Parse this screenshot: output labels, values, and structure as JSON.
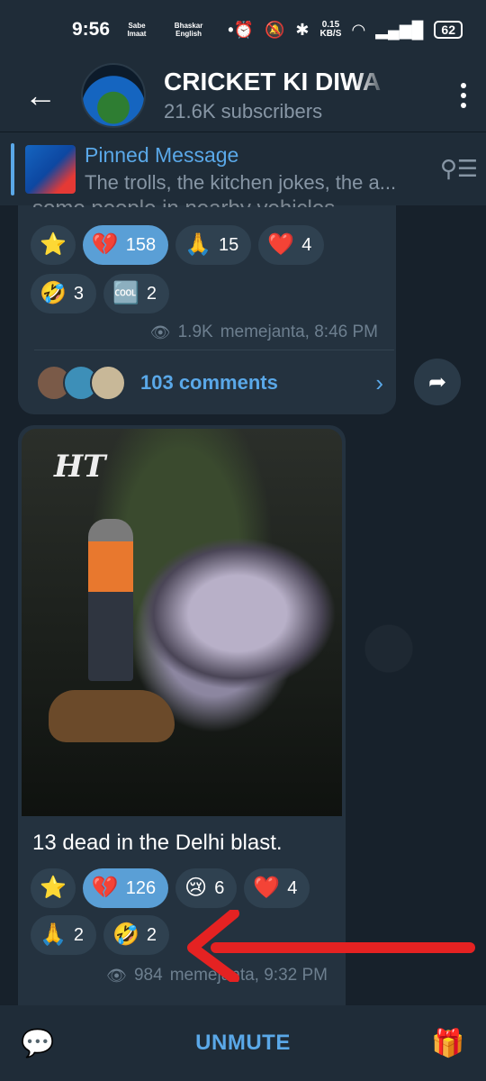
{
  "status_bar": {
    "time": "9:56",
    "mini1": "Sabe Imaat",
    "mini2": "Bhaskar English",
    "speed_value": "0.15",
    "speed_unit": "KB/S",
    "battery": "62"
  },
  "header": {
    "title": "CRICKET KI DIWA",
    "subscribers": "21.6K subscribers"
  },
  "pinned": {
    "title": "Pinned Message",
    "text": "The trolls, the kitchen jokes, the a..."
  },
  "post1": {
    "cut_text": "some people in nearby vehicles.",
    "reactions_row1": [
      {
        "emoji": "⭐",
        "count": ""
      },
      {
        "emoji": "💔",
        "count": "158",
        "active": true
      },
      {
        "emoji": "🙏",
        "count": "15"
      },
      {
        "emoji": "❤️",
        "count": "4"
      }
    ],
    "reactions_row2": [
      {
        "emoji": "🤣",
        "count": "3"
      },
      {
        "emoji": "🆒",
        "count": "2"
      }
    ],
    "views": "1.9K",
    "author_time": "memejanta, 8:46 PM",
    "comments": "103 comments"
  },
  "post2": {
    "photo_logo": "HT",
    "caption": "13 dead in the Delhi blast.",
    "reactions_row1": [
      {
        "emoji": "⭐",
        "count": ""
      },
      {
        "emoji": "💔",
        "count": "126",
        "active": true
      },
      {
        "emoji": "😢",
        "count": "6"
      },
      {
        "emoji": "❤️",
        "count": "4"
      }
    ],
    "reactions_row2": [
      {
        "emoji": "🙏",
        "count": "2"
      },
      {
        "emoji": "🤣",
        "count": "2"
      }
    ],
    "views": "984",
    "author_time": "memejanta, 9:32 PM"
  },
  "bottom": {
    "unmute": "UNMUTE"
  },
  "colors": {
    "accent": "#5aa8e8",
    "annotation_arrow": "#e52222"
  }
}
